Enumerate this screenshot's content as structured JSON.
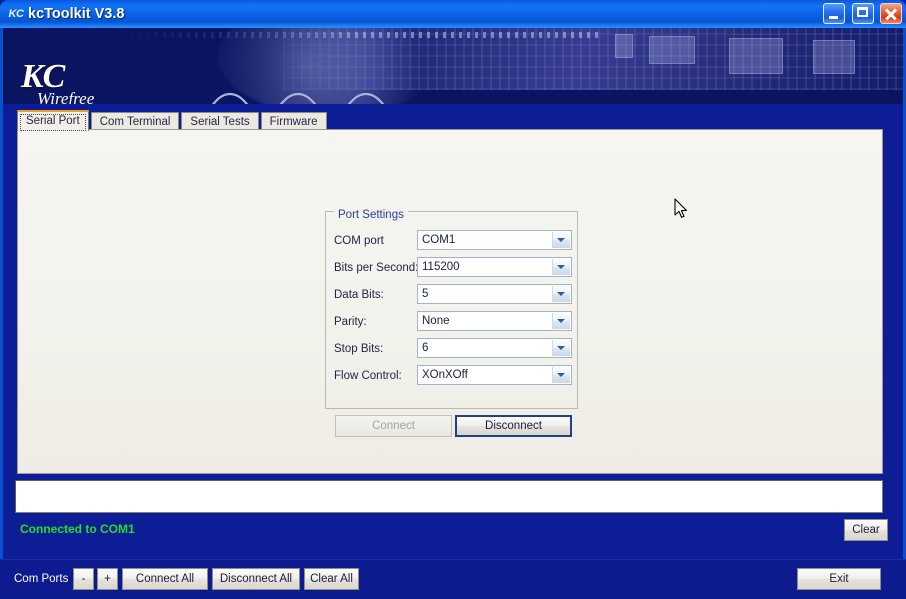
{
  "window": {
    "title": "kcToolkit V3.8",
    "icon_label": "KC",
    "controls": [
      {
        "name": "minimize",
        "glyph": "_"
      },
      {
        "name": "maximize",
        "glyph": "□"
      },
      {
        "name": "close",
        "glyph": "✕"
      }
    ]
  },
  "banner": {
    "logo_primary": "KC",
    "logo_secondary": "Wirefree"
  },
  "tabs": [
    {
      "label": "Serial Port",
      "active": true
    },
    {
      "label": "Com Terminal",
      "active": false
    },
    {
      "label": "Serial Tests",
      "active": false
    },
    {
      "label": "Firmware",
      "active": false
    }
  ],
  "port_settings": {
    "group_title": "Port Settings",
    "fields": [
      {
        "label": "COM port",
        "value": "COM1"
      },
      {
        "label": "Bits per Second:",
        "value": "115200"
      },
      {
        "label": "Data Bits:",
        "value": "5"
      },
      {
        "label": "Parity:",
        "value": "None"
      },
      {
        "label": "Stop Bits:",
        "value": "6"
      },
      {
        "label": "Flow Control:",
        "value": "XOnXOff"
      }
    ],
    "connect_label": "Connect",
    "connect_enabled": false,
    "disconnect_label": "Disconnect",
    "disconnect_enabled": true
  },
  "log": {
    "value": "",
    "placeholder": ""
  },
  "status": {
    "text": "Connected to COM1",
    "color": "#22dd22"
  },
  "clear_label": "Clear",
  "bottom_bar": {
    "com_ports_label": "Com Ports",
    "minus_label": "-",
    "plus_label": "+",
    "connect_all_label": "Connect All",
    "disconnect_all_label": "Disconnect All",
    "clear_all_label": "Clear All",
    "exit_label": "Exit"
  },
  "colors": {
    "title_bar": "#0b63ec",
    "window_body": "#0c1d96",
    "banner": "#0b1460",
    "tab_accent": "#f0a020",
    "status_green": "#22dd22",
    "group_title": "#2b3fa0"
  }
}
